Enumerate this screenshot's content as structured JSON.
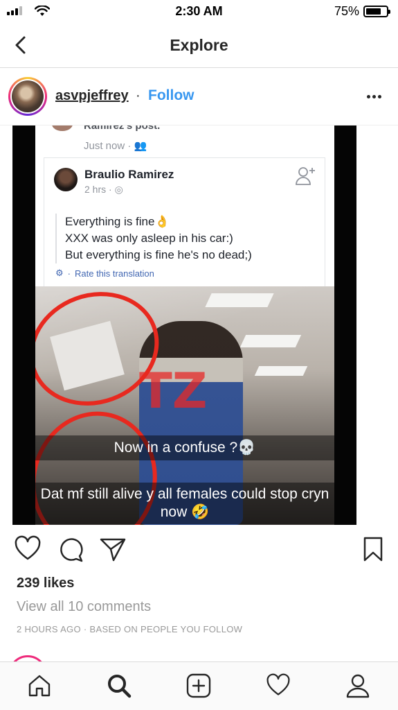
{
  "status_bar": {
    "time": "2:30 AM",
    "battery_percent": "75%",
    "battery_level": 0.75,
    "signal_icon": "cellular-signal-icon",
    "wifi_icon": "wifi-icon"
  },
  "nav": {
    "title": "Explore",
    "back_icon": "chevron-left-icon"
  },
  "post": {
    "username": "asvpjeffrey",
    "separator": "·",
    "follow_label": "Follow",
    "more_icon": "more-options-icon",
    "image": {
      "fb_previous_author": "Ramirez's post.",
      "fb_previous_time": "Just now ·",
      "fb_author": "Braulio Ramirez",
      "fb_time": "2 hrs ·",
      "fb_lines": [
        "Everything is fine👌",
        "XXX was only asleep in his car:)",
        "But everything is fine he's no dead;)"
      ],
      "fb_translate": "Rate this translation",
      "caption_1": "Now in a  confuse ?💀",
      "caption_2_line1": "Dat mf still alive y all females could stop cryn",
      "caption_2_line2": "now 🤣"
    },
    "likes": "239 likes",
    "view_comments": "View all 10 comments",
    "time_ago": "2 HOURS AGO",
    "meta_sep": "·",
    "based_on": "BASED ON PEOPLE YOU FOLLOW"
  },
  "tab_bar": {
    "items": [
      "home-icon",
      "search-icon",
      "add-post-icon",
      "heart-icon",
      "profile-icon"
    ],
    "active": "search-icon"
  },
  "colors": {
    "follow_blue": "#3897f0",
    "text": "#262626",
    "muted": "#999999",
    "divider": "#dbdbdb",
    "annotation_red": "#e8291f"
  }
}
